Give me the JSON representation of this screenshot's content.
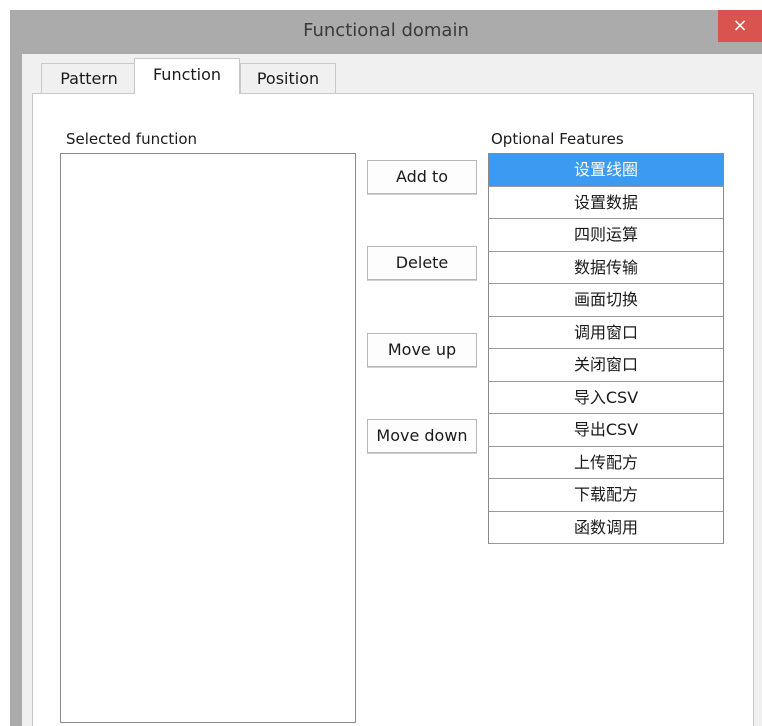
{
  "window": {
    "title": "Functional domain",
    "close_glyph": "×"
  },
  "tabs": [
    {
      "label": "Pattern",
      "active": false
    },
    {
      "label": "Function",
      "active": true
    },
    {
      "label": "Position",
      "active": false
    }
  ],
  "selected_function": {
    "label": "Selected function",
    "items": []
  },
  "actions": {
    "add_to": "Add to",
    "delete": "Delete",
    "move_up": "Move up",
    "move_down": "Move down"
  },
  "optional_features": {
    "label": "Optional Features",
    "selected_index": 0,
    "items": [
      "设置线圈",
      "设置数据",
      "四则运算",
      "数据传输",
      "画面切换",
      "调用窗口",
      "关闭窗口",
      "导入CSV",
      "导出CSV",
      "上传配方",
      "下载配方",
      "函数调用"
    ]
  },
  "colors": {
    "selection": "#3c9bf0",
    "close_button": "#d9534f",
    "titlebar": "#ababab"
  },
  "icons": {
    "close": "close-icon"
  }
}
